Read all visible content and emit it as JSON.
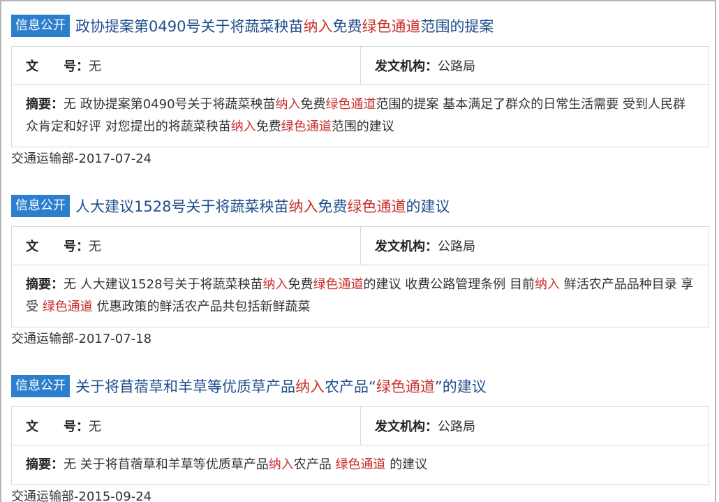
{
  "results": [
    {
      "badge": "信息公开",
      "title_parts": [
        {
          "text": "政协提案第0490号关于将蔬菜秧苗",
          "hl": false
        },
        {
          "text": "纳入",
          "hl": true
        },
        {
          "text": "免费",
          "hl": false
        },
        {
          "text": "绿色通道",
          "hl": true
        },
        {
          "text": "范围的提案",
          "hl": false
        }
      ],
      "doc_number_label": "文",
      "doc_number_label2": "号：",
      "doc_number_value": "无",
      "issuer_label": "发文机构：",
      "issuer_value": "公路局",
      "abstract_label": "摘要：",
      "abstract_parts": [
        {
          "text": "无 政协提案第0490号关于将蔬菜秧苗",
          "hl": false
        },
        {
          "text": "纳入",
          "hl": true
        },
        {
          "text": "免费",
          "hl": false
        },
        {
          "text": "绿色通道",
          "hl": true
        },
        {
          "text": "范围的提案 基本满足了群众的日常生活需要 受到人民群众肯定和好评 对您提出的将蔬菜秧苗",
          "hl": false
        },
        {
          "text": "纳入",
          "hl": true
        },
        {
          "text": "免费",
          "hl": false
        },
        {
          "text": "绿色通道",
          "hl": true
        },
        {
          "text": "范围的建议",
          "hl": false
        }
      ],
      "source_date": "交通运输部-2017-07-24"
    },
    {
      "badge": "信息公开",
      "title_parts": [
        {
          "text": "人大建议1528号关于将蔬菜秧苗",
          "hl": false
        },
        {
          "text": "纳入",
          "hl": true
        },
        {
          "text": "免费",
          "hl": false
        },
        {
          "text": "绿色通道",
          "hl": true
        },
        {
          "text": "的建议",
          "hl": false
        }
      ],
      "doc_number_label": "文",
      "doc_number_label2": "号：",
      "doc_number_value": "无",
      "issuer_label": "发文机构：",
      "issuer_value": "公路局",
      "abstract_label": "摘要：",
      "abstract_parts": [
        {
          "text": "无 人大建议1528号关于将蔬菜秧苗",
          "hl": false
        },
        {
          "text": "纳入",
          "hl": true
        },
        {
          "text": "免费",
          "hl": false
        },
        {
          "text": "绿色通道",
          "hl": true
        },
        {
          "text": "的建议 收费公路管理条例 目前",
          "hl": false
        },
        {
          "text": "纳入",
          "hl": true
        },
        {
          "text": " 鲜活农产品品种目录 享受 ",
          "hl": false
        },
        {
          "text": "绿色通道",
          "hl": true
        },
        {
          "text": " 优惠政策的鲜活农产品共包括新鲜蔬菜",
          "hl": false
        }
      ],
      "source_date": "交通运输部-2017-07-18"
    },
    {
      "badge": "信息公开",
      "title_parts": [
        {
          "text": "关于将苜蓿草和羊草等优质草产品",
          "hl": false
        },
        {
          "text": "纳入",
          "hl": true
        },
        {
          "text": "农产品“",
          "hl": false
        },
        {
          "text": "绿色通道",
          "hl": true
        },
        {
          "text": "”的建议",
          "hl": false
        }
      ],
      "doc_number_label": "文",
      "doc_number_label2": "号：",
      "doc_number_value": "无",
      "issuer_label": "发文机构：",
      "issuer_value": "公路局",
      "abstract_label": "摘要：",
      "abstract_parts": [
        {
          "text": "无 关于将苜蓿草和羊草等优质草产品",
          "hl": false
        },
        {
          "text": "纳入",
          "hl": true
        },
        {
          "text": "农产品 ",
          "hl": false
        },
        {
          "text": "绿色通道",
          "hl": true
        },
        {
          "text": " 的建议",
          "hl": false
        }
      ],
      "source_date": "交通运输部-2015-09-24"
    }
  ],
  "colors": {
    "badge_bg": "#2b7fcc",
    "title": "#1f4e8c",
    "highlight": "#c9302c"
  }
}
